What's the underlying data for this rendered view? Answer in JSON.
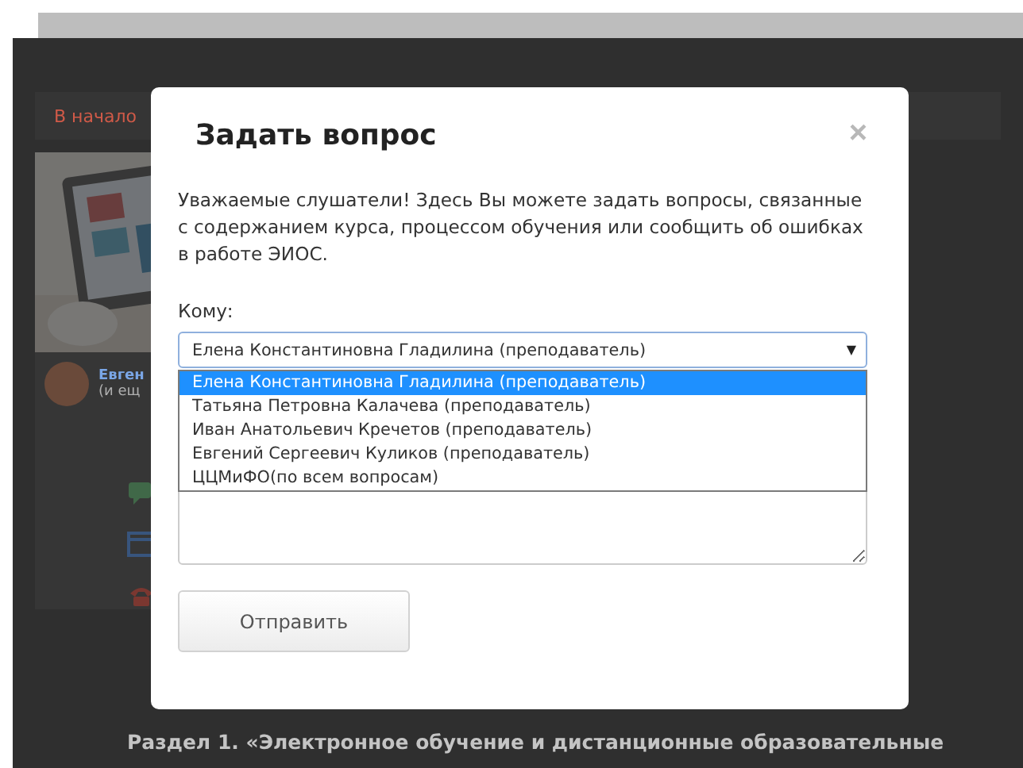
{
  "background": {
    "breadcrumb": "В начало",
    "author_name": "Евген",
    "author_note": "(и ещ",
    "section_heading": "Раздел 1. «Электронное обучение и дистанционные образовательные"
  },
  "dialog": {
    "title": "Задать вопрос",
    "close": "×",
    "description": "Уважаемые слушатели! Здесь Вы можете задать вопросы, связанные с содержанием курса, процессом обучения или сообщить об ошибках в работе ЭИОС.",
    "recipient_label": "Кому:",
    "recipient_select": {
      "value": "Елена Константиновна Гладилина (преподаватель)",
      "caret": "▼",
      "expanded": true,
      "options": [
        {
          "label": "Елена Константиновна Гладилина (преподаватель)",
          "selected": true
        },
        {
          "label": "Татьяна Петровна Калачева (преподаватель)",
          "selected": false
        },
        {
          "label": "Иван Анатольевич Кречетов (преподаватель)",
          "selected": false
        },
        {
          "label": "Евгений Сергеевич Куликов (преподаватель)",
          "selected": false
        },
        {
          "label": "ЦЦМиФО(по всем вопросам)",
          "selected": false
        }
      ]
    },
    "submit": "Отправить"
  }
}
